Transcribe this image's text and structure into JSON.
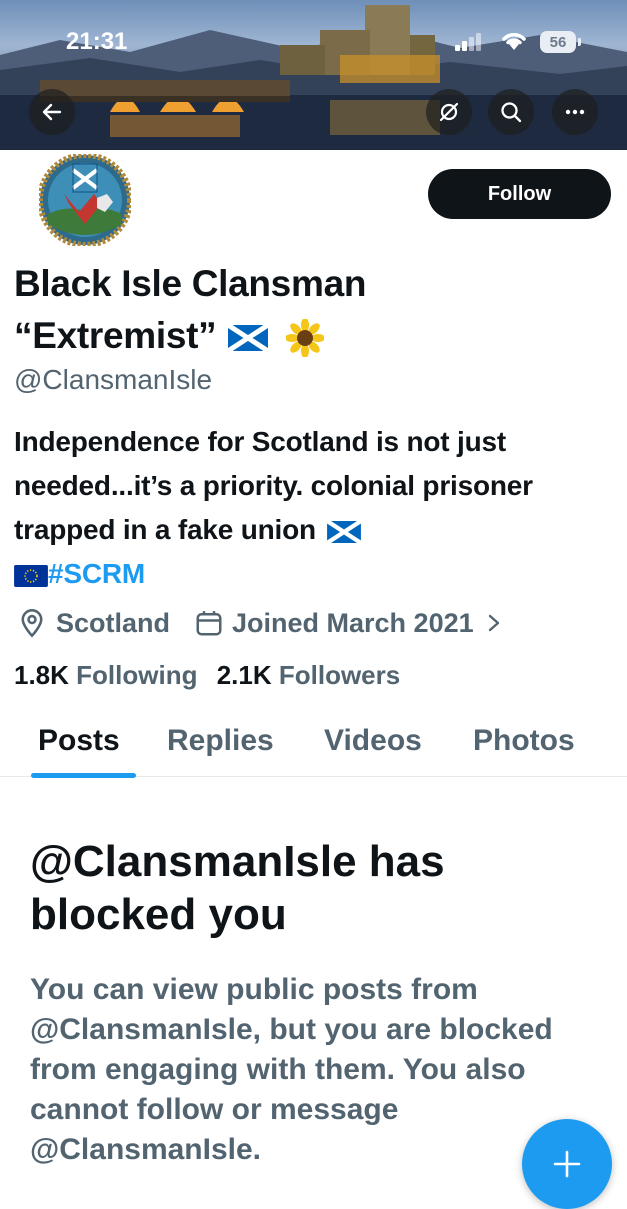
{
  "status_bar": {
    "time": "21:31",
    "battery_level": "56"
  },
  "profile": {
    "display_name_line1": "Black Isle Clansman",
    "display_name_line2": "“Extremist”",
    "handle": "@ClansmanIsle",
    "follow_label": "Follow",
    "bio_text": "Independence for Scotland is not just needed...it’s a priority. colonial prisoner trapped in a fake union",
    "bio_hashtag": "#SCRM",
    "location": "Scotland",
    "joined": "Joined March 2021",
    "following_count": "1.8K",
    "following_label": "Following",
    "followers_count": "2.1K",
    "followers_label": "Followers"
  },
  "tabs": [
    "Posts",
    "Replies",
    "Videos",
    "Photos"
  ],
  "blocked": {
    "title": "@ClansmanIsle has blocked you",
    "message": "You can view public posts from @ClansmanIsle, but you are blocked from engaging with them. You also cannot follow or message @ClansmanIsle."
  },
  "colors": {
    "accent": "#1d9bf0",
    "text": "#0f1419",
    "secondary": "#536471"
  },
  "icons": [
    "back-arrow-icon",
    "hide-reposts-icon",
    "search-icon",
    "more-icon",
    "location-pin-icon",
    "calendar-icon",
    "chevron-right-icon",
    "compose-plus-icon",
    "scottish-flag-icon",
    "sunflower-icon",
    "eu-flag-icon"
  ]
}
